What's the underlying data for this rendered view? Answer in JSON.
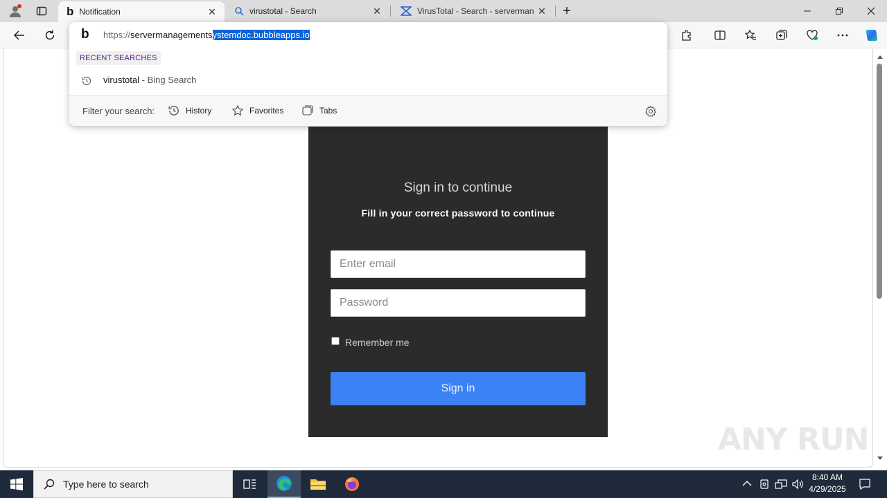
{
  "browser": {
    "tabs": [
      {
        "title": "Notification",
        "icon": "bing-icon",
        "active": true
      },
      {
        "title": "virustotal - Search",
        "icon": "search-icon",
        "active": false
      },
      {
        "title": "VirusTotal - Search - servermanag",
        "icon": "virustotal-icon",
        "active": false
      }
    ],
    "new_tab_glyph": "+",
    "close_glyph": "✕"
  },
  "omnibox": {
    "url_proto": "https://",
    "url_host_plain": "servermanagements",
    "url_host_selected": "ystemdoc.bubbleapps.io",
    "recent_label": "RECENT SEARCHES",
    "suggestion_query": "virustotal",
    "suggestion_source": " - Bing Search",
    "filter_label": "Filter your search:",
    "filters": [
      "History",
      "Favorites",
      "Tabs"
    ]
  },
  "login": {
    "title": "Sign in to continue",
    "subtitle": "Fill in your correct password to continue",
    "email_placeholder": "Enter email",
    "password_placeholder": "Password",
    "remember_label": "Remember me",
    "remember_checked": false,
    "signin_label": "Sign in"
  },
  "watermark": "ANY RUN",
  "taskbar": {
    "search_placeholder": "Type here to search",
    "time": "8:40 AM",
    "date": "4/29/2025"
  },
  "colors": {
    "card_bg": "#2b2b2b",
    "signin_bg": "#3b82f6",
    "taskbar_bg": "#1f2b3a",
    "selection": "#0a64d8"
  }
}
